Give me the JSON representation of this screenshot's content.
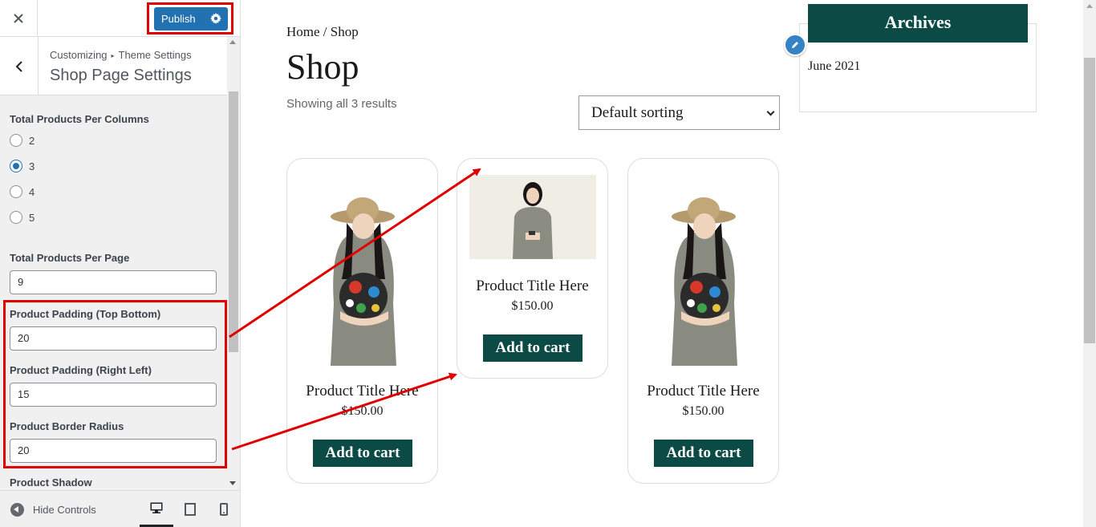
{
  "customizer": {
    "close_icon": "close-icon",
    "publish_label": "Publish",
    "publish_settings_icon": "gear-icon",
    "back_icon": "chevron-left-icon",
    "breadcrumb_parent": "Customizing",
    "breadcrumb_separator": "▸",
    "breadcrumb_section": "Theme Settings",
    "section_title": "Shop Page Settings",
    "columns": {
      "label": "Total Products Per Columns",
      "options": [
        "2",
        "3",
        "4",
        "5"
      ],
      "selected": "3"
    },
    "per_page": {
      "label": "Total Products Per Page",
      "value": "9"
    },
    "padding_tb": {
      "label": "Product Padding (Top Bottom)",
      "value": "20"
    },
    "padding_rl": {
      "label": "Product Padding (Right Left)",
      "value": "15"
    },
    "border_radius": {
      "label": "Product Border Radius",
      "value": "20"
    },
    "shadow": {
      "label": "Product Shadow"
    },
    "footer": {
      "hide_controls_label": "Hide Controls",
      "devices": [
        "desktop",
        "tablet",
        "mobile"
      ],
      "active_device": "desktop"
    }
  },
  "preview": {
    "breadcrumb": "Home / Shop",
    "title": "Shop",
    "result_count": "Showing all 3 results",
    "sorting_value": "Default sorting",
    "products": [
      {
        "title": "Product Title Here",
        "price": "$150.00",
        "button": "Add to cart"
      },
      {
        "title": "Product Title Here",
        "price": "$150.00",
        "button": "Add to cart"
      },
      {
        "title": "Product Title Here",
        "price": "$150.00",
        "button": "Add to cart"
      }
    ],
    "sidebar": {
      "archives_title": "Archives",
      "archives_items": [
        "June 2021"
      ]
    }
  },
  "colors": {
    "publish_blue": "#2271b1",
    "brand_green": "#0c4a45",
    "annotation_red": "#e00000"
  }
}
